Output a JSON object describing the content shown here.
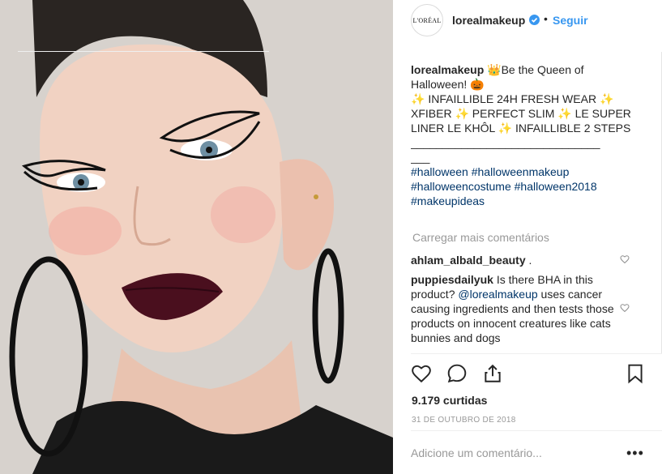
{
  "post": {
    "photo_alt": "",
    "brand_logo_text": "L'ORÉAL",
    "username": "lorealmakeup",
    "separator": "•",
    "follow_label": "Seguir",
    "verified_icon": "verified-badge-icon"
  },
  "caption": {
    "username": "lorealmakeup",
    "line1_text": " 👑Be the Queen of Halloween! 🎃",
    "line2_text": "✨ INFAILLIBLE 24H FRESH WEAR ✨ XFIBER ✨ PERFECT SLIM ✨ LE SUPER LINER LE KHÔL ✨ INFAILLIBLE 2 STEPS",
    "rule_text": "______________________________",
    "short_rule": "___",
    "hashtags": [
      "#halloween",
      "#halloweenmakeup",
      "#halloweencostume",
      "#halloween2018",
      "#makeupideas"
    ]
  },
  "load_more_label": "Carregar mais comentários",
  "comments": [
    {
      "username": "ahlam_albald_beauty",
      "text": "."
    },
    {
      "username": "puppiesdailyuk",
      "text_before": "Is there BHA in this product? ",
      "mention": "@lorealmakeup",
      "text_after": " uses cancer causing ingredients and then tests those products on innocent creatures like cats bunnies and dogs"
    }
  ],
  "actions": {
    "like_icon": "heart-icon",
    "comment_icon": "comment-icon",
    "share_icon": "share-icon",
    "save_icon": "bookmark-icon"
  },
  "likes_text": "9.179 curtidas",
  "date_text": "31 DE OUTUBRO DE 2018",
  "add_comment": {
    "placeholder": "Adicione um comentário...",
    "more_label": "•••"
  },
  "colors": {
    "link_blue": "#3897f0",
    "hashtag_blue": "#003569",
    "muted_gray": "#999999",
    "text_dark": "#262626",
    "lip_color": "#4a0f1e"
  }
}
